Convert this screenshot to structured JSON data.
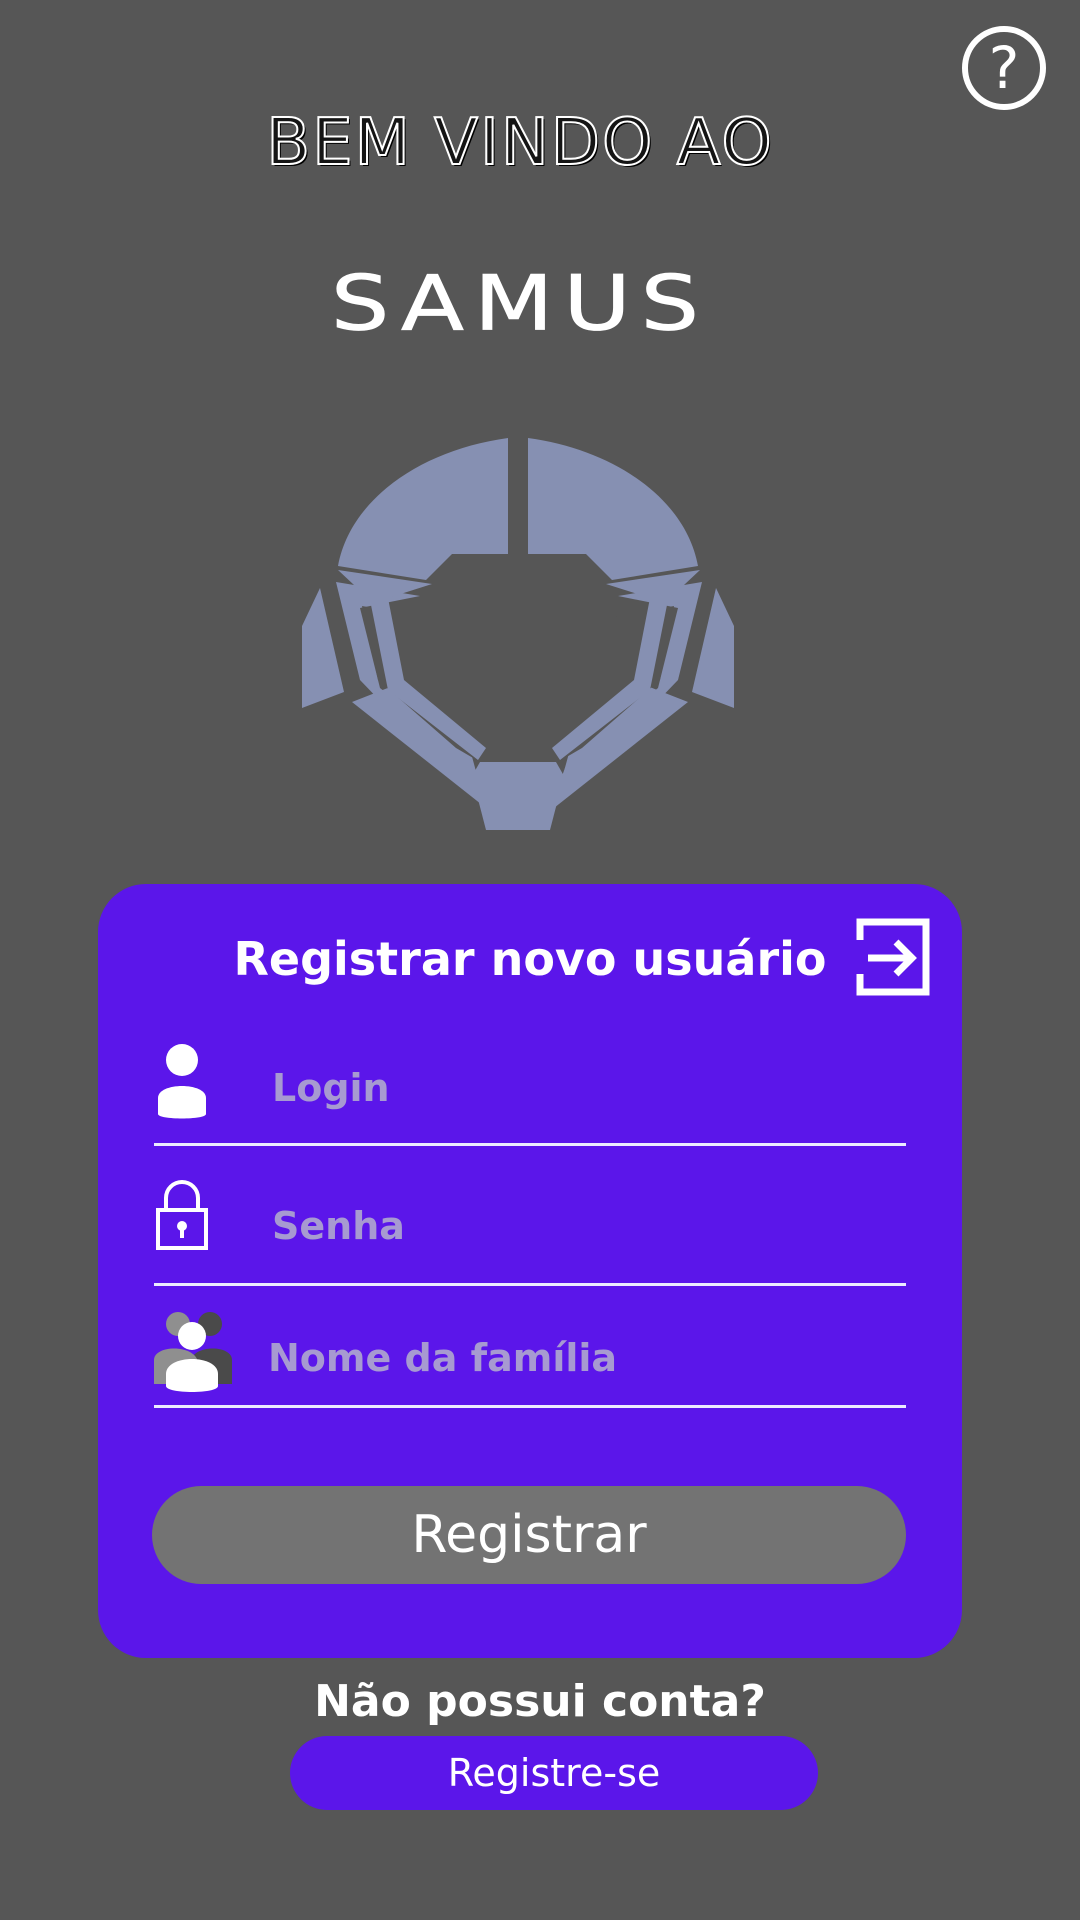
{
  "header": {
    "help_icon_glyph": "?",
    "welcome_text": "BEM VINDO AO",
    "brand_name": "SAMUS",
    "logo_icon": "helmet-logo-icon"
  },
  "register_card": {
    "title": "Registrar novo usuário",
    "exit_icon": "exit-icon",
    "fields": [
      {
        "label": "Login",
        "icon": "user-icon"
      },
      {
        "label": "Senha",
        "icon": "lock-icon"
      },
      {
        "label": "Nome da família",
        "icon": "family-icon"
      }
    ],
    "submit_label": "Registrar"
  },
  "footer": {
    "prompt": "Não possui conta?",
    "signup_label": "Registre-se"
  },
  "colors": {
    "background": "#565656",
    "card": "#5b16ea",
    "logo": "#8690b2",
    "button": "#737373",
    "placeholder": "#a79ad1"
  }
}
